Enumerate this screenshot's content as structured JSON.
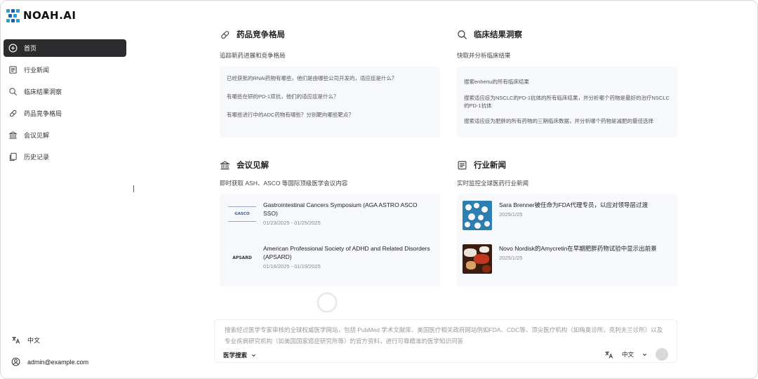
{
  "brand": {
    "name": "NOAH.AI",
    "accent": "#1aa3d9"
  },
  "sidebar": {
    "items": [
      {
        "label": "首页",
        "icon": "plus-circle-icon",
        "active": true
      },
      {
        "label": "行业新闻",
        "icon": "newspaper-icon"
      },
      {
        "label": "临床结果洞察",
        "icon": "search-icon"
      },
      {
        "label": "药品竞争格局",
        "icon": "pill-icon"
      },
      {
        "label": "会议见解",
        "icon": "building-columns-icon"
      },
      {
        "label": "历史记录",
        "icon": "files-icon"
      }
    ],
    "language": "中文",
    "user_email": "admin@example.com"
  },
  "panels": {
    "drug": {
      "title": "药品竞争格局",
      "subtitle": "追踪新药进展和竞争格局",
      "questions": [
        "已经获批的RNAi药物有哪些，他们是由哪些公司开发的，适应症是什么？",
        "有哪些在研的PD-1双抗，他们的适应症是什么？",
        "有哪些进行中的ADC药物有哪些？分别靶向哪些靶点？"
      ]
    },
    "clinical": {
      "title": "临床结果洞察",
      "subtitle": "快取并分析临床结果",
      "questions": [
        "搜索enhertu的所有临床结果",
        "搜索适应症为NSCLC的PD-1抗体的所有临床结果，并分析哪个药物是最好的治疗NSCLC的PD-1抗体",
        "搜索适应症为肥胖的所有药物的三期临床数据，并分析哪个药物是减肥的最佳选择"
      ]
    },
    "conference": {
      "title": "会议见解",
      "subtitle": "即时获取 ASH、ASCO 等国际顶级医学会议内容",
      "cards": [
        {
          "logo": "GASCO",
          "title": "Gastrointestinal Cancers Symposium (AGA ASTRO ASCO SSO)",
          "date": "01/23/2025 - 01/25/2025"
        },
        {
          "logo": "APSARD",
          "title": "American Professional Society of ADHD and Related Disorders (APSARD)",
          "date": "01/16/2025 - 01/19/2025"
        }
      ]
    },
    "news": {
      "title": "行业新闻",
      "subtitle": "实时监控全球医药行业新闻",
      "cards": [
        {
          "title": "Sara Brenner被任命为FDA代理专员，以应对领导层过渡",
          "date": "2025/1/25"
        },
        {
          "title": "Novo Nordisk的Amycretin在早期肥胖药物试验中显示出前景",
          "date": "2025/1/25"
        }
      ]
    }
  },
  "search": {
    "placeholder": "搜索经过医学专家审核的全球权威医学网站，包括 PubMed 学术文献库、美国医疗相关政府网站例如FDA、CDC等、顶尖医疗机构（如梅奥诊所、克利夫兰诊所）以及专业疾病研究机构（如美国国家癌症研究所等）的官方资料，进行可靠精准的医学知识问答",
    "mode": "医学搜索",
    "language": "中文"
  }
}
